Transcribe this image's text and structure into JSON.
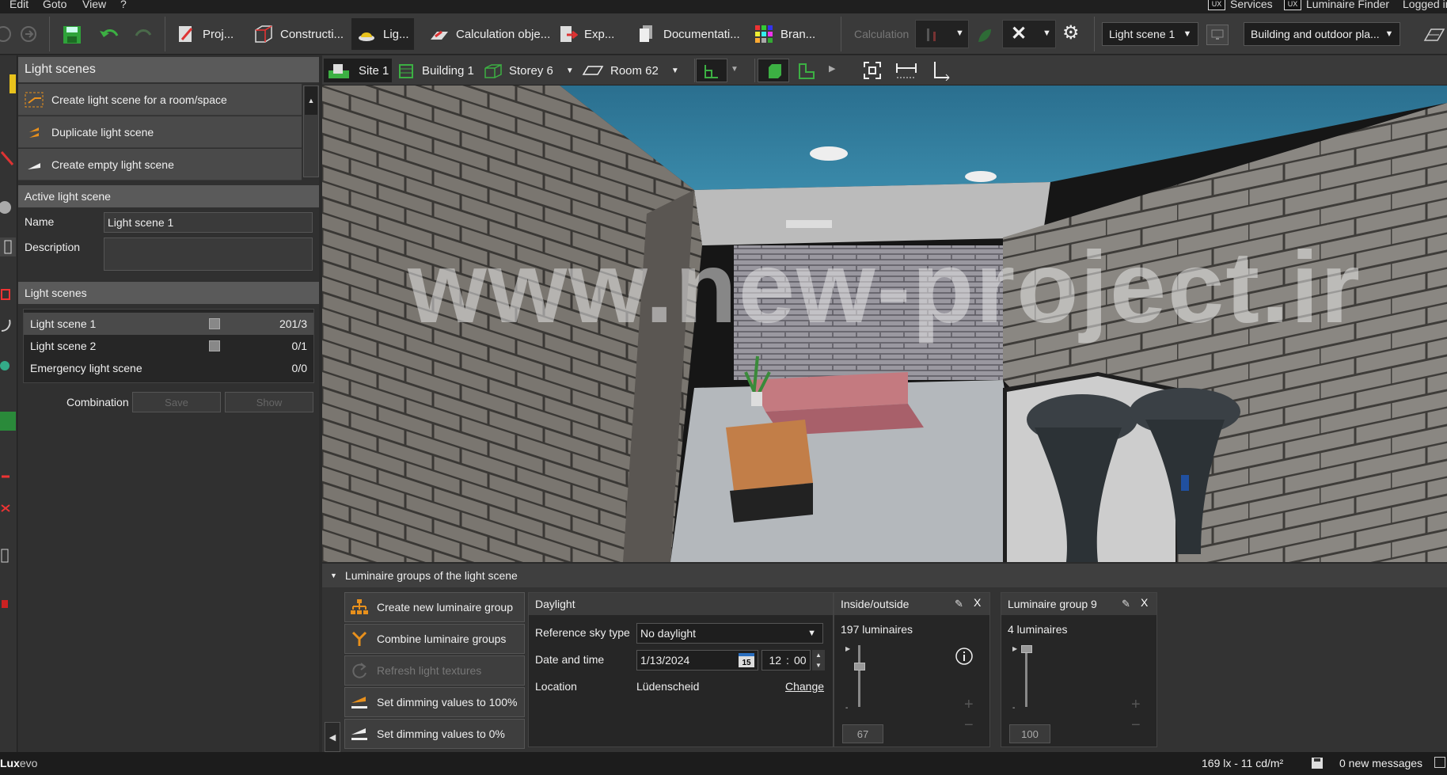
{
  "menu": {
    "items": [
      "Edit",
      "Goto",
      "View",
      "?"
    ],
    "services": "Services",
    "luminaire_finder": "Luminaire Finder",
    "logged_in": "Logged in",
    "ux_badge": "UX"
  },
  "toolbar": {
    "tabs": [
      {
        "label": "Proj...",
        "icon": "project-icon"
      },
      {
        "label": "Constructi...",
        "icon": "construction-icon"
      },
      {
        "label": "Lig...",
        "icon": "light-icon"
      },
      {
        "label": "Calculation obje...",
        "icon": "calculation-objects-icon"
      },
      {
        "label": "Exp...",
        "icon": "export-icon"
      },
      {
        "label": "Documentati...",
        "icon": "documentation-icon"
      },
      {
        "label": "Bran...",
        "icon": "branding-icon"
      }
    ],
    "calculation_label": "Calculation",
    "light_scene_select": "Light scene 1",
    "plan_select": "Building and outdoor pla..."
  },
  "left_panel": {
    "light_scenes_title": "Light scenes",
    "actions": [
      "Create light scene for a room/space",
      "Duplicate light scene",
      "Create empty light scene"
    ],
    "active_title": "Active light scene",
    "name_label": "Name",
    "name_value": "Light scene 1",
    "description_label": "Description",
    "description_value": "",
    "list_title": "Light scenes",
    "scenes": [
      {
        "name": "Light scene 1",
        "count": "201/3",
        "has_check": true
      },
      {
        "name": "Light scene 2",
        "count": "0/1",
        "has_check": true
      },
      {
        "name": "Emergency light scene",
        "count": "0/0",
        "has_check": false
      }
    ],
    "combination_label": "Combination",
    "save_label": "Save",
    "show_label": "Show"
  },
  "viewbar": {
    "crumbs": [
      {
        "label": "Site 1",
        "icon": "site-icon"
      },
      {
        "label": "Building 1",
        "icon": "building-icon"
      },
      {
        "label": "Storey 6",
        "icon": "storey-icon"
      },
      {
        "label": "Room 62",
        "icon": "room-icon"
      }
    ]
  },
  "viewport": {
    "watermark": "www.new-project.ir"
  },
  "bottom": {
    "title": "Luminaire groups of the light scene",
    "buttons": [
      {
        "label": "Create new luminaire group",
        "disabled": false
      },
      {
        "label": "Combine luminaire groups",
        "disabled": false
      },
      {
        "label": "Refresh light textures",
        "disabled": true
      },
      {
        "label": "Set dimming values to 100%",
        "disabled": false
      },
      {
        "label": "Set dimming values to 0%",
        "disabled": false
      }
    ],
    "daylight": {
      "title": "Daylight",
      "sky_label": "Reference sky type",
      "sky_value": "No daylight",
      "datetime_label": "Date and time",
      "date_value": "1/13/2024",
      "calendar_day": "15",
      "hour": "12",
      "minute": "00",
      "location_label": "Location",
      "location_value": "Lüdenscheid",
      "change_label": "Change"
    },
    "groups": [
      {
        "title": "Inside/outside",
        "count": "197 luminaires",
        "value": "67",
        "level": 0.67,
        "info": true
      },
      {
        "title": "Luminaire group 9",
        "count": "4 luminaires",
        "value": "100",
        "level": 1.0,
        "info": false
      }
    ]
  },
  "status": {
    "brand": "Lux",
    "brand_suffix": "evo",
    "illuminance": "169 lx - 11 cd/m²",
    "messages": "0 new messages"
  },
  "colors": {
    "accent_orange": "#e8901c",
    "green": "#3cb043",
    "ceiling_blue": "#2e7a9a"
  }
}
